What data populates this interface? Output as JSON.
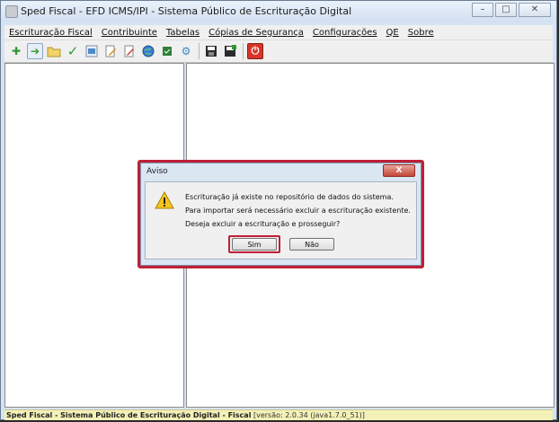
{
  "window": {
    "title": "Sped Fiscal - EFD ICMS/IPI - Sistema Público de Escrituração Digital"
  },
  "menu": [
    {
      "label": "Escrituração Fiscal"
    },
    {
      "label": "Contribuinte"
    },
    {
      "label": "Tabelas"
    },
    {
      "label": "Cópias de Segurança"
    },
    {
      "label": "Configurações"
    },
    {
      "label": "QE"
    },
    {
      "label": "Sobre"
    }
  ],
  "toolbar": {
    "icons": [
      "new-icon",
      "import-icon",
      "open-folder-icon",
      "validate-check-icon",
      "sign-icon",
      "edit-icon",
      "edit-document-icon",
      "transmit-globe-icon",
      "receipt-icon",
      "tools-icon",
      "save-icon",
      "save-as-icon",
      "exit-icon"
    ]
  },
  "dialog": {
    "title": "Aviso",
    "close_label": "X",
    "lines": [
      "Escrituração já existe no repositório de dados do sistema.",
      "Para importar será necessário excluir a escrituração existente.",
      "Deseja excluir a escrituração e prosseguir?"
    ],
    "yes_label": "Sim",
    "no_label": "Não"
  },
  "statusbar": {
    "app_label": "Sped Fiscal - Sistema Público de Escrituração Digital - Fiscal",
    "version": "[versão: 2.0.34 (java1.7.0_51)]"
  },
  "colors": {
    "highlight": "#c01f35",
    "status_bg": "#f3f1b8"
  }
}
